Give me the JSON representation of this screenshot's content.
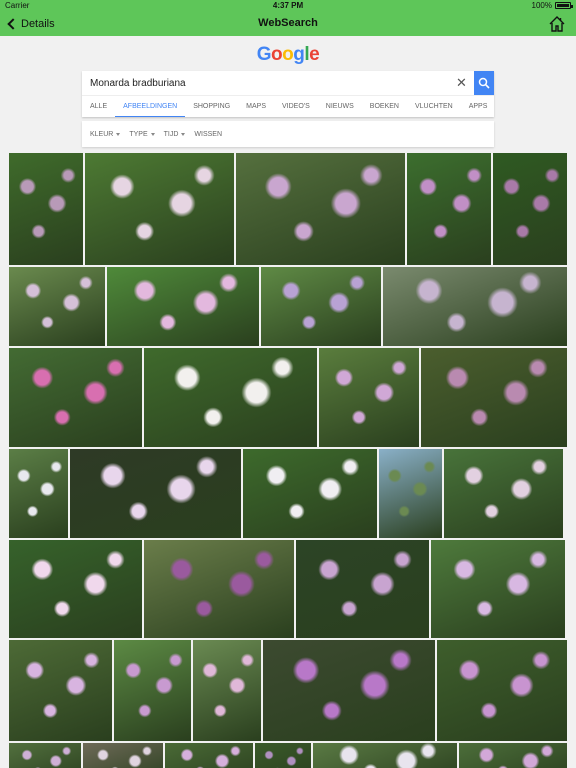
{
  "status": {
    "carrier": "Carrier",
    "time": "4:37 PM",
    "battery": "100%"
  },
  "nav": {
    "back_label": "Details",
    "title": "WebSearch"
  },
  "google_logo": {
    "letters": [
      "G",
      "o",
      "o",
      "g",
      "l",
      "e"
    ],
    "colors": [
      "#4285f4",
      "#ea4335",
      "#fbbc05",
      "#4285f4",
      "#34a853",
      "#ea4335"
    ]
  },
  "search": {
    "query": "Monarda bradburiana",
    "clear_symbol": "✕"
  },
  "tabs": [
    {
      "label": "ALLE",
      "active": false
    },
    {
      "label": "AFBEELDINGEN",
      "active": true
    },
    {
      "label": "SHOPPING",
      "active": false
    },
    {
      "label": "MAPS",
      "active": false
    },
    {
      "label": "VIDEO'S",
      "active": false
    },
    {
      "label": "NIEUWS",
      "active": false
    },
    {
      "label": "BOEKEN",
      "active": false
    },
    {
      "label": "VLUCHTEN",
      "active": false
    },
    {
      "label": "APPS",
      "active": false
    }
  ],
  "filters": [
    {
      "label": "KLEUR",
      "dropdown": true
    },
    {
      "label": "TYPE",
      "dropdown": true
    },
    {
      "label": "TIJD",
      "dropdown": true
    },
    {
      "label": "WISSEN",
      "dropdown": false
    }
  ],
  "image_results": [
    {
      "height": 112,
      "items": [
        {
          "w": 74,
          "c": [
            "#3f6b2b",
            "#b89ab8"
          ]
        },
        {
          "w": 149,
          "c": [
            "#4d7a33",
            "#e6d5e2"
          ]
        },
        {
          "w": 169,
          "c": [
            "#55703e",
            "#c9a6cf"
          ]
        },
        {
          "w": 84,
          "c": [
            "#3c6e2e",
            "#c18fc6"
          ]
        },
        {
          "w": 74,
          "c": [
            "#2f5a22",
            "#a97aa8"
          ]
        }
      ]
    },
    {
      "height": 79,
      "items": [
        {
          "w": 96,
          "c": [
            "#6a8a4e",
            "#d5c0d8"
          ]
        },
        {
          "w": 152,
          "c": [
            "#4f8a3a",
            "#e3b8de"
          ]
        },
        {
          "w": 120,
          "c": [
            "#5f8a45",
            "#b9a2d4"
          ]
        },
        {
          "w": 184,
          "c": [
            "#7a8a6e",
            "#c6b4cf"
          ]
        }
      ]
    },
    {
      "height": 99,
      "items": [
        {
          "w": 133,
          "c": [
            "#436b33",
            "#d86fb0"
          ]
        },
        {
          "w": 173,
          "c": [
            "#3f6a2c",
            "#f2f0ee"
          ]
        },
        {
          "w": 100,
          "c": [
            "#5a7d3d",
            "#d0a8d6"
          ]
        },
        {
          "w": 146,
          "c": [
            "#4b5e2e",
            "#b98ab0"
          ]
        }
      ]
    },
    {
      "height": 89,
      "items": [
        {
          "w": 59,
          "c": [
            "#5b7e46",
            "#e8e8ee"
          ]
        },
        {
          "w": 171,
          "c": [
            "#2e3a26",
            "#e8d6ec"
          ]
        },
        {
          "w": 134,
          "c": [
            "#3d6a2c",
            "#f0eef2"
          ]
        },
        {
          "w": 63,
          "c": [
            "#8ab0c8",
            "#6b8a52"
          ]
        },
        {
          "w": 119,
          "c": [
            "#48733a",
            "#e2d0e0"
          ]
        }
      ]
    },
    {
      "height": 98,
      "items": [
        {
          "w": 133,
          "c": [
            "#36622b",
            "#f0d8ec"
          ]
        },
        {
          "w": 150,
          "c": [
            "#6a7d4a",
            "#9a5a9e"
          ]
        },
        {
          "w": 133,
          "c": [
            "#2c4426",
            "#c8a4d0"
          ]
        },
        {
          "w": 134,
          "c": [
            "#4e7a3c",
            "#d8b8e2"
          ]
        }
      ]
    },
    {
      "height": 101,
      "items": [
        {
          "w": 103,
          "c": [
            "#4d6a36",
            "#d8b4e0"
          ]
        },
        {
          "w": 77,
          "c": [
            "#5c8a44",
            "#c89ad0"
          ]
        },
        {
          "w": 68,
          "c": [
            "#6a8a52",
            "#e0b8d8"
          ]
        },
        {
          "w": 172,
          "c": [
            "#3c4a30",
            "#b878c8"
          ]
        },
        {
          "w": 130,
          "c": [
            "#3e5e2c",
            "#c894d0"
          ]
        }
      ]
    },
    {
      "height": 40,
      "items": [
        {
          "w": 72,
          "c": [
            "#52703e",
            "#cfb0d6"
          ]
        },
        {
          "w": 80,
          "c": [
            "#6e6a58",
            "#e0d4e0"
          ]
        },
        {
          "w": 88,
          "c": [
            "#4a6a36",
            "#d6b0dc"
          ]
        },
        {
          "w": 56,
          "c": [
            "#3a5a2a",
            "#b090c0"
          ]
        },
        {
          "w": 144,
          "c": [
            "#5a7a44",
            "#e8e4ee"
          ]
        },
        {
          "w": 110,
          "c": [
            "#4c6e3a",
            "#d2a8d8"
          ]
        }
      ]
    }
  ]
}
